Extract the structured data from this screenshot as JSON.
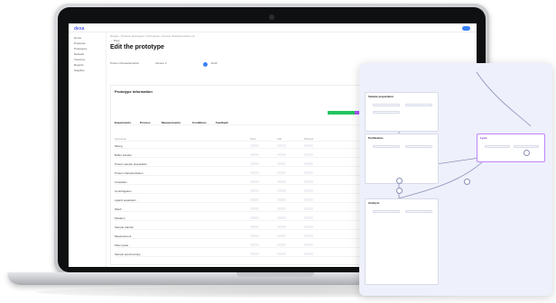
{
  "app": {
    "logo": "dexa"
  },
  "sidebar": {
    "items": [
      "Home",
      "Protocols",
      "Prototypes",
      "Network",
      "Inventory",
      "Reports",
      "Supplies"
    ]
  },
  "header": {
    "breadcrumb": "Design  ›  Protocol prototypes  ›  Prototypes  ›  Protein Characterization v2",
    "back": "← Back",
    "title": "Edit the prototype",
    "meta": [
      {
        "label": "Protocol",
        "value": "Protein Characterization"
      },
      {
        "label": "Version",
        "value": "Version 2"
      },
      {
        "label": "Status",
        "value": "Draft"
      }
    ]
  },
  "card": {
    "heading": "Prototype information",
    "tabs": [
      "Experiments",
      "Process",
      "Measurements",
      "Conditions",
      "Feedback"
    ],
    "columns": [
      "Operation",
      "Pass",
      "Fail",
      "Method",
      "Type"
    ],
    "rows": [
      "Mixing",
      "Buffer transfer",
      "Protein sample preparation",
      "Protein characterization",
      "Incubation",
      "Centrifugation",
      "Ligand separation",
      "Wash",
      "Filtration",
      "Sample transfer",
      "Measurement",
      "Filter lysate",
      "Sample spectroscopy"
    ]
  },
  "panel": {
    "nodes": [
      "Sample preparation",
      "Purification",
      "Lysis",
      "Analysis"
    ]
  },
  "colors": {
    "accent": "#3b82f6",
    "bar_green": "#22c55e",
    "bar_purple": "#a855f7",
    "bar_pink": "#ec4899",
    "bar_dark": "#111827"
  }
}
